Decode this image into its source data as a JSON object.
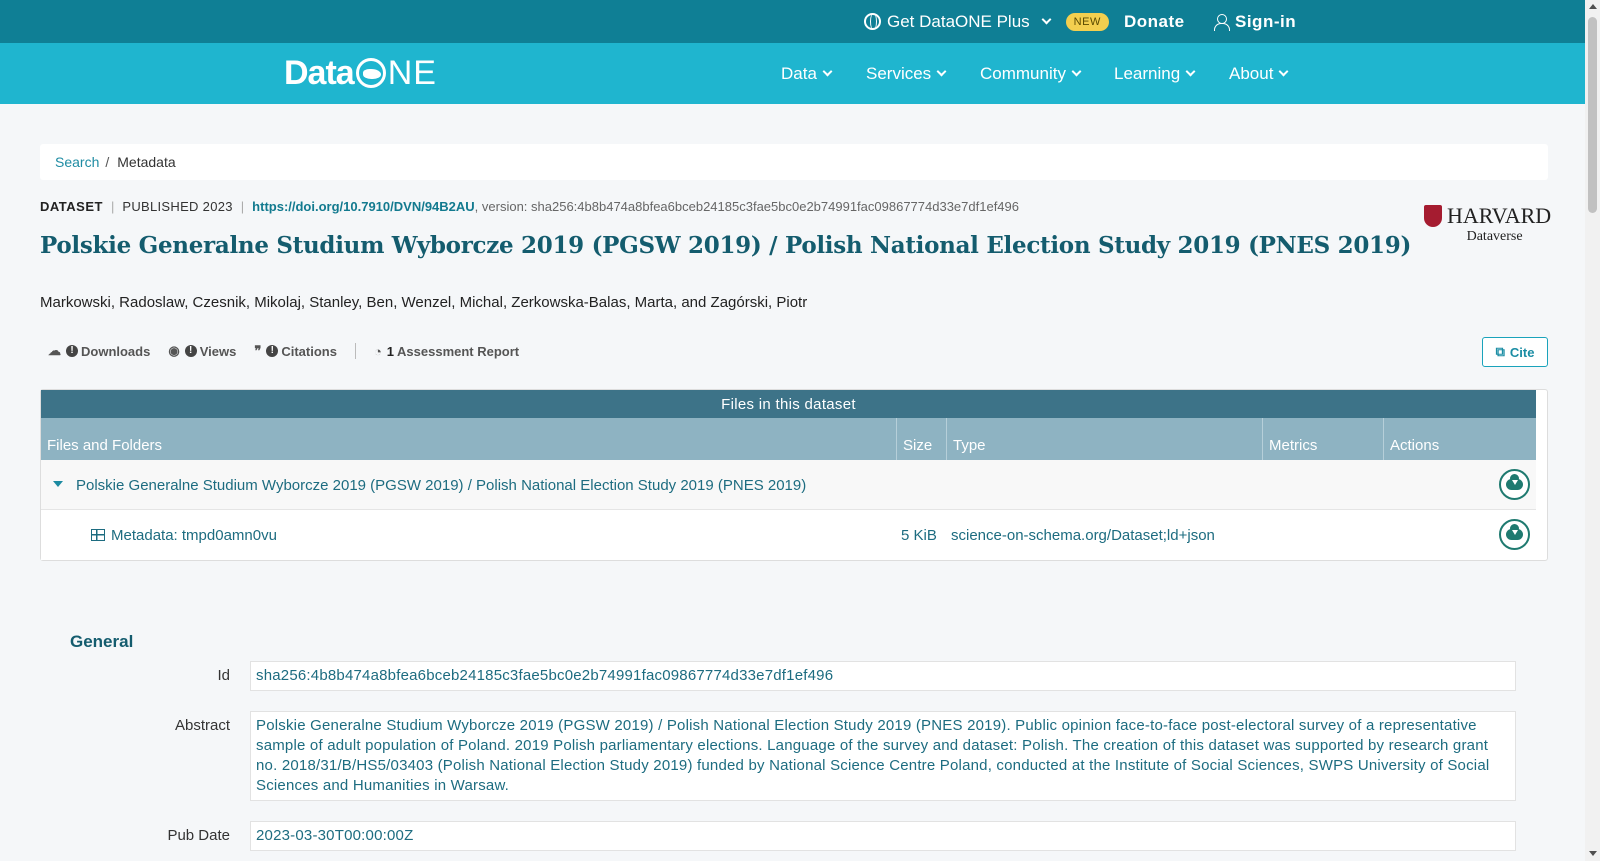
{
  "topbar": {
    "plus_label": "Get DataONE Plus",
    "new_badge": "NEW",
    "donate": "Donate",
    "signin": "Sign-in"
  },
  "nav": {
    "logo_data": "Data",
    "logo_ne": "NE",
    "items": [
      "Data",
      "Services",
      "Community",
      "Learning",
      "About"
    ]
  },
  "breadcrumb": {
    "search": "Search",
    "separator": "/",
    "current": "Metadata"
  },
  "dataset": {
    "type": "DATASET",
    "published": "PUBLISHED 2023",
    "doi": "https://doi.org/10.7910/DVN/94B2AU",
    "version": ", version: sha256:4b8b474a8bfea6bceb24185c3fae5bc0e2b74991fac09867774d33e7df1ef496",
    "repository_name": "HARVARD",
    "repository_sub": "Dataverse",
    "title": "Polskie Generalne Studium Wyborcze 2019 (PGSW 2019) / Polish National Election Study 2019 (PNES 2019)",
    "authors": "Markowski, Radoslaw, Czesnik, Mikolaj, Stanley, Ben, Wenzel, Michal, Zerkowska-Balas, Marta, and Zagórski, Piotr"
  },
  "metrics": {
    "downloads": "Downloads",
    "views": "Views",
    "citations": "Citations",
    "assessment_count": "1",
    "assessment": "Assessment Report",
    "cite": "Cite"
  },
  "files": {
    "heading": "Files in this dataset",
    "columns": [
      "Files and Folders",
      "Size",
      "Type",
      "Metrics",
      "Actions"
    ],
    "folder": "Polskie Generalne Studium Wyborcze 2019 (PGSW 2019) / Polish National Election Study 2019 (PNES 2019)",
    "file_name": "Metadata: tmpd0amn0vu",
    "file_size": "5 KiB",
    "file_type": "science-on-schema.org/Dataset;ld+json"
  },
  "general": {
    "heading": "General",
    "fields": [
      {
        "label": "Id",
        "value": "sha256:4b8b474a8bfea6bceb24185c3fae5bc0e2b74991fac09867774d33e7df1ef496"
      },
      {
        "label": "Abstract",
        "value": "Polskie Generalne Studium Wyborcze 2019 (PGSW 2019) / Polish National Election Study 2019 (PNES 2019). Public opinion face-to-face post-electoral survey of a representative sample of adult population of Poland. 2019 Polish parliamentary elections. Language of the survey and dataset: Polish. The creation of this dataset was supported by research grant no. 2018/31/B/HS5/03403 (Polish National Election Study 2019) funded by National Science Centre Poland, conducted at the Institute of Social Sciences, SWPS University of Social Sciences and Humanities in Warsaw."
      },
      {
        "label": "Pub Date",
        "value": "2023-03-30T00:00:00Z"
      }
    ]
  },
  "icons": {
    "globe": "globe-icon",
    "person": "person-icon",
    "downloads": "cloud-download-icon",
    "views": "eye-icon",
    "citations": "quote-icon",
    "assessment": "dashboard-icon",
    "cite": "copy-icon",
    "table": "table-icon"
  },
  "colors": {
    "topbar": "#0f7f95",
    "navbar": "#1fb5cf",
    "title": "#145c6e",
    "files_header": "#3d7388",
    "files_columns": "#8eb3c2",
    "harvard_crimson": "#a51c30",
    "new_badge": "#f3cf4f"
  }
}
